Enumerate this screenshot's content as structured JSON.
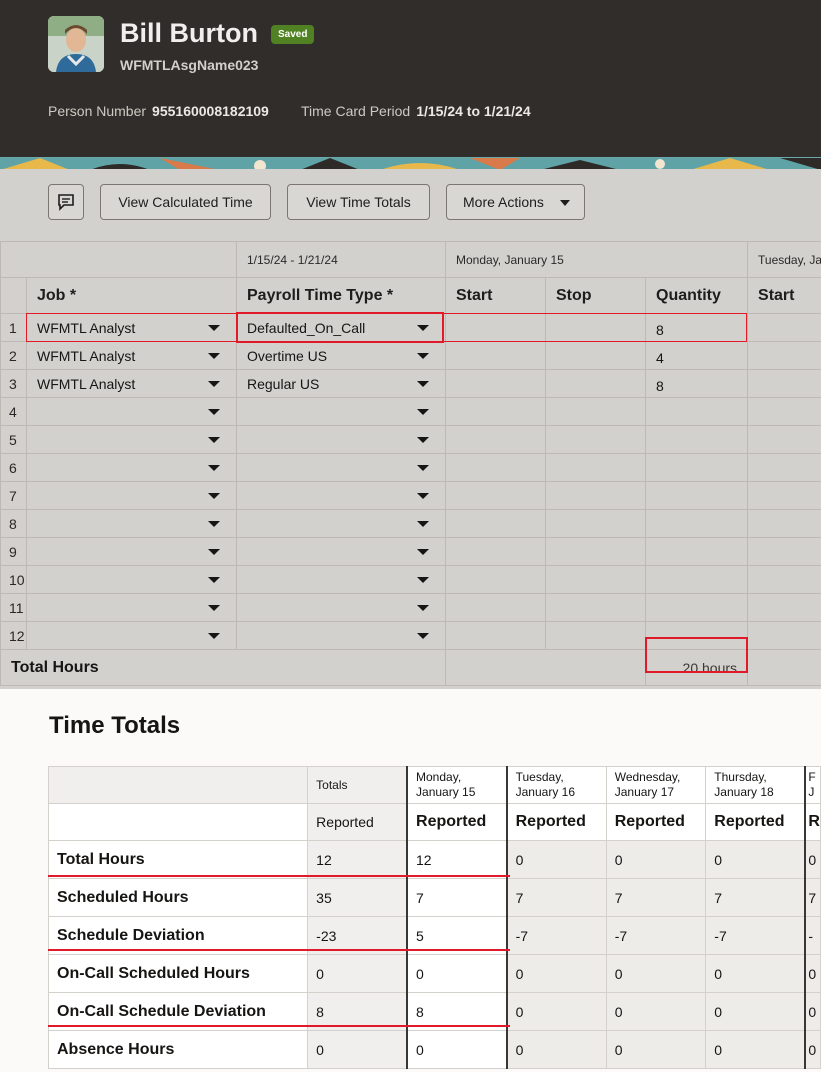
{
  "header": {
    "person_name": "Bill Burton",
    "status_badge": "Saved",
    "assignment_name": "WFMTLAsgName023",
    "person_number_label": "Person Number",
    "person_number": "955160008182109",
    "period_label": "Time Card Period",
    "period_value": "1/15/24 to 1/21/24"
  },
  "toolbar": {
    "comment_icon": "comment-icon",
    "view_calculated": "View Calculated Time",
    "view_totals": "View Time Totals",
    "more_actions": "More Actions"
  },
  "entry_grid": {
    "period_header": "1/15/24 - 1/21/24",
    "day1_header": "Monday, January 15",
    "day2_header": "Tuesday, Janu",
    "columns": [
      "Job *",
      "Payroll Time Type *",
      "Start",
      "Stop",
      "Quantity",
      "Start"
    ],
    "rows": [
      {
        "n": "1",
        "job": "WFMTL Analyst",
        "type": "Defaulted_On_Call",
        "qty": "8"
      },
      {
        "n": "2",
        "job": "WFMTL Analyst",
        "type": "Overtime US",
        "qty": "4"
      },
      {
        "n": "3",
        "job": "WFMTL Analyst",
        "type": "Regular US",
        "qty": "8"
      },
      {
        "n": "4",
        "job": "",
        "type": "",
        "qty": ""
      },
      {
        "n": "5",
        "job": "",
        "type": "",
        "qty": ""
      },
      {
        "n": "6",
        "job": "",
        "type": "",
        "qty": ""
      },
      {
        "n": "7",
        "job": "",
        "type": "",
        "qty": ""
      },
      {
        "n": "8",
        "job": "",
        "type": "",
        "qty": ""
      },
      {
        "n": "9",
        "job": "",
        "type": "",
        "qty": ""
      },
      {
        "n": "10",
        "job": "",
        "type": "",
        "qty": ""
      },
      {
        "n": "11",
        "job": "",
        "type": "",
        "qty": ""
      },
      {
        "n": "12",
        "job": "",
        "type": "",
        "qty": ""
      }
    ],
    "total_label": "Total Hours",
    "total_value": "20 hours"
  },
  "time_totals": {
    "title": "Time Totals",
    "totals_header": "Totals",
    "day_headers": [
      "Monday,\nJanuary 15",
      "Tuesday,\nJanuary 16",
      "Wednesday,\nJanuary 17",
      "Thursday,\nJanuary 18",
      "F\nJ"
    ],
    "reported": "Reported",
    "reported_cut": "R",
    "rows": [
      {
        "label": "Total Hours",
        "total": "12",
        "days": [
          "12",
          "0",
          "0",
          "0",
          "0"
        ]
      },
      {
        "label": "Scheduled Hours",
        "total": "35",
        "days": [
          "7",
          "7",
          "7",
          "7",
          "7"
        ]
      },
      {
        "label": "Schedule Deviation",
        "total": "-23",
        "days": [
          "5",
          "-7",
          "-7",
          "-7",
          "-"
        ]
      },
      {
        "label": "On-Call Scheduled Hours",
        "total": "0",
        "days": [
          "0",
          "0",
          "0",
          "0",
          "0"
        ]
      },
      {
        "label": "On-Call Schedule Deviation",
        "total": "8",
        "days": [
          "8",
          "0",
          "0",
          "0",
          "0"
        ]
      },
      {
        "label": "Absence Hours",
        "total": "0",
        "days": [
          "0",
          "0",
          "0",
          "0",
          "0"
        ]
      }
    ]
  },
  "colors": {
    "highlight": "#e11a2a",
    "badge": "#508223",
    "header_bg": "#312d2a"
  }
}
